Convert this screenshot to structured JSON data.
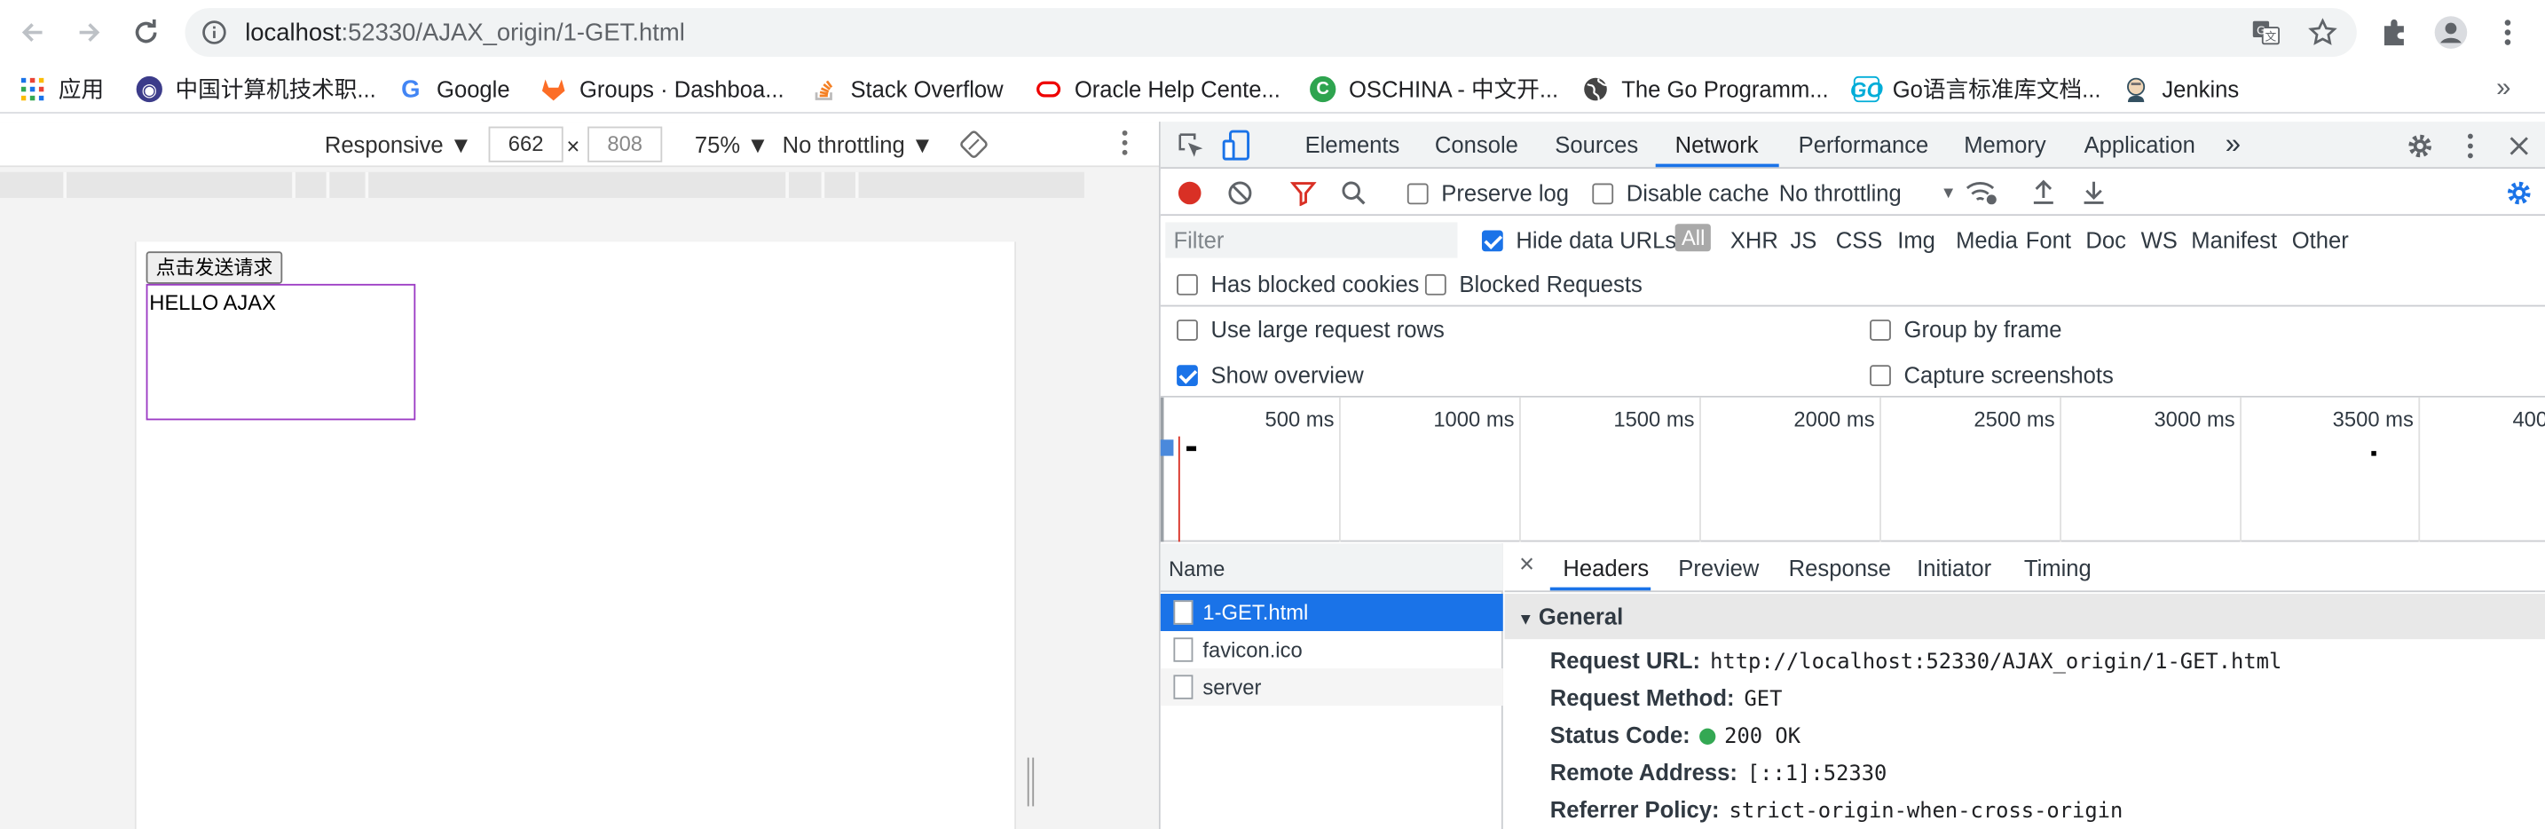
{
  "browser": {
    "url_host": "localhost",
    "url_rest": ":52330/AJAX_origin/1-GET.html"
  },
  "bookmarks": [
    {
      "label": "应用",
      "icon": "apps-grid-icon"
    },
    {
      "label": "中国计算机技术职...",
      "icon": "site-icon"
    },
    {
      "label": "Google",
      "icon": "google-icon"
    },
    {
      "label": "Groups · Dashboa...",
      "icon": "gitlab-icon"
    },
    {
      "label": "Stack Overflow",
      "icon": "stackoverflow-icon"
    },
    {
      "label": "Oracle Help Cente...",
      "icon": "oracle-icon"
    },
    {
      "label": "OSCHINA - 中文开...",
      "icon": "oschina-icon"
    },
    {
      "label": "The Go Programm...",
      "icon": "globe-icon"
    },
    {
      "label": "Go语言标准库文档...",
      "icon": "go-icon"
    },
    {
      "label": "Jenkins",
      "icon": "jenkins-icon"
    }
  ],
  "device_toolbar": {
    "device": "Responsive ▼",
    "width": "662",
    "times": "×",
    "height": "808",
    "zoom": "75% ▼",
    "throttle": "No throttling ▼"
  },
  "page": {
    "button_label": "点击发送请求",
    "result_text": "HELLO AJAX"
  },
  "devtools": {
    "tabs": [
      "Elements",
      "Console",
      "Sources",
      "Network",
      "Performance",
      "Memory",
      "Application"
    ],
    "active_tab": "Network",
    "more": "»",
    "toolbar": {
      "preserve_log": "Preserve log",
      "disable_cache": "Disable cache",
      "throttling": "No throttling"
    },
    "filter": {
      "placeholder": "Filter",
      "hide_data_urls": "Hide data URLs",
      "types": [
        "All",
        "XHR",
        "JS",
        "CSS",
        "Img",
        "Media",
        "Font",
        "Doc",
        "WS",
        "Manifest",
        "Other"
      ]
    },
    "options": {
      "has_blocked_cookies": "Has blocked cookies",
      "blocked_requests": "Blocked Requests",
      "use_large_rows": "Use large request rows",
      "group_by_frame": "Group by frame",
      "show_overview": "Show overview",
      "capture_screenshots": "Capture screenshots"
    },
    "timeline_ticks": [
      "500 ms",
      "1000 ms",
      "1500 ms",
      "2000 ms",
      "2500 ms",
      "3000 ms",
      "3500 ms",
      "400"
    ],
    "requests_header": "Name",
    "requests": [
      "1-GET.html",
      "favicon.ico",
      "server"
    ],
    "detail_tabs": [
      "Headers",
      "Preview",
      "Response",
      "Initiator",
      "Timing"
    ],
    "detail_close": "×",
    "general": {
      "title": "General",
      "rows": [
        {
          "k": "Request URL:",
          "v": "http://localhost:52330/AJAX_origin/1-GET.html"
        },
        {
          "k": "Request Method:",
          "v": "GET"
        },
        {
          "k": "Status Code:",
          "v": "200 OK"
        },
        {
          "k": "Remote Address:",
          "v": "[::1]:52330"
        },
        {
          "k": "Referrer Policy:",
          "v": "strict-origin-when-cross-origin"
        }
      ]
    }
  },
  "colors": {
    "accent": "#1a73e8",
    "record_red": "#d93025",
    "status_green": "#34a853",
    "result_border": "#9b3ac4"
  }
}
